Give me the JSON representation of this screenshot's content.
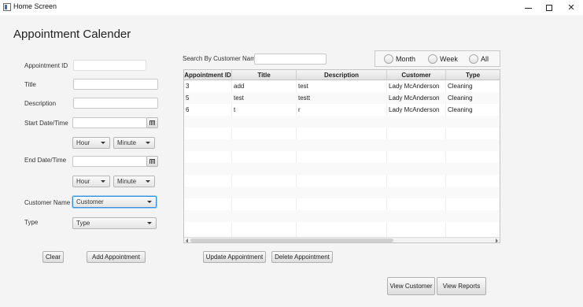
{
  "window": {
    "title": "Home Screen"
  },
  "page_title": "Appointment Calender",
  "form": {
    "appointment_id_label": "Appointment ID",
    "title_label": "Title",
    "description_label": "Description",
    "start_label": "Start Date/Time",
    "end_label": "End Date/Time",
    "customer_label": "Customer Name",
    "type_label": "Type",
    "start_hour": "Hour",
    "start_minute": "Minute",
    "end_hour": "Hour",
    "end_minute": "Minute",
    "customer_value": "Customer",
    "type_value": "Type",
    "clear_button": "Clear",
    "add_button": "Add Appointment"
  },
  "search": {
    "label": "Search By Customer Name",
    "value": ""
  },
  "filters": {
    "month": "Month",
    "week": "Week",
    "all": "All"
  },
  "table": {
    "columns": [
      "Appointment ID",
      "Title",
      "Description",
      "Customer",
      "Type"
    ],
    "rows": [
      [
        "3",
        "add",
        "test",
        "Lady McAnderson",
        "Cleaning"
      ],
      [
        "5",
        "test",
        "testt",
        "Lady McAnderson",
        "Cleaning"
      ],
      [
        "6",
        "t",
        "r",
        "Lady McAnderson",
        "Cleaning"
      ]
    ]
  },
  "actions": {
    "update": "Update Appointment",
    "delete": "Delete Appointment",
    "view_customer": "View Customer",
    "view_reports": "View Reports"
  },
  "icons": {
    "app": "window-app-icon",
    "minimize": "minimize-icon",
    "maximize": "maximize-icon",
    "close": "close-icon",
    "calendar": "calendar-icon",
    "dropdown": "chevron-down-icon"
  }
}
